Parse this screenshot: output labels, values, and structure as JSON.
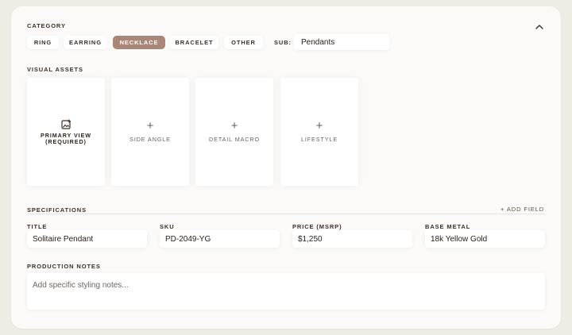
{
  "category": {
    "title": "CATEGORY",
    "chips": [
      {
        "label": "RING",
        "active": false
      },
      {
        "label": "EARRING",
        "active": false
      },
      {
        "label": "NECKLACE",
        "active": true
      },
      {
        "label": "BRACELET",
        "active": false
      },
      {
        "label": "OTHER",
        "active": false
      }
    ],
    "sub_label": "SUB:",
    "sub_value": "Pendants"
  },
  "visual_assets": {
    "title": "VISUAL ASSETS",
    "tiles": [
      {
        "label": "PRIMARY VIEW (REQUIRED)",
        "icon": "add-image-icon"
      },
      {
        "label": "SIDE ANGLE",
        "icon": "plus-icon"
      },
      {
        "label": "DETAIL MACRO",
        "icon": "plus-icon"
      },
      {
        "label": "LIFESTYLE",
        "icon": "plus-icon"
      }
    ],
    "plus_glyph": "+"
  },
  "specifications": {
    "title": "SPECIFICATIONS",
    "add_field_label": "+ ADD FIELD",
    "fields": [
      {
        "label": "TITLE",
        "value": "Solitaire Pendant"
      },
      {
        "label": "SKU",
        "value": "PD-2049-YG"
      },
      {
        "label": "PRICE (MSRP)",
        "value": "$1,250"
      },
      {
        "label": "BASE METAL",
        "value": "18k Yellow Gold"
      }
    ]
  },
  "production_notes": {
    "title": "PRODUCTION NOTES",
    "placeholder": "Add specific styling notes..."
  },
  "colors": {
    "page_bg": "#efebe5",
    "card_bg": "#fbfaf8",
    "accent_chip": "#a98677",
    "text_dark": "#3d3026"
  },
  "icons": {
    "collapse": "chevron-up-icon"
  }
}
